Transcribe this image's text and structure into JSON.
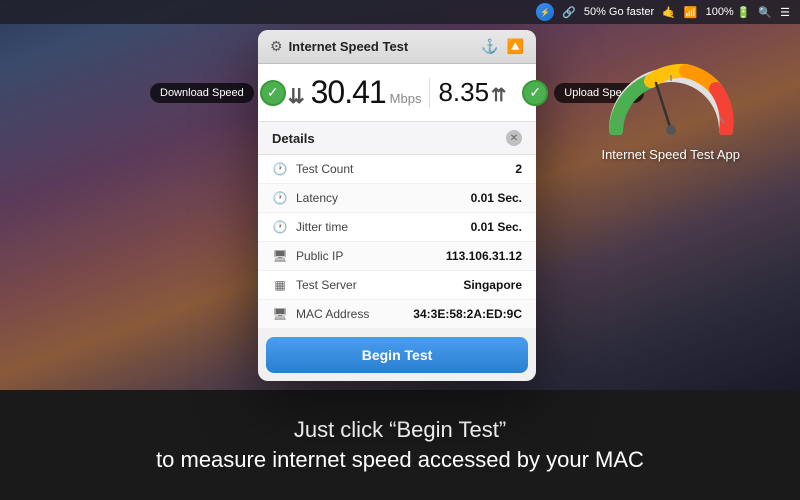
{
  "menubar": {
    "battery_percent": "50%",
    "go_faster": "Go faster",
    "wifi_strength": "100%",
    "battery_full": "100%"
  },
  "window": {
    "title": "Internet Speed Test",
    "gear_icon": "⚙",
    "anchor_icon": "⚓",
    "share_icon": "📤"
  },
  "speeds": {
    "download_value": "30.41",
    "upload_value": "8.35",
    "unit": "Mbps",
    "download_label": "Download Speed",
    "upload_label": "Upload Speed"
  },
  "details": {
    "title": "Details",
    "rows": [
      {
        "icon": "🕐",
        "label": "Test Count",
        "value": "2"
      },
      {
        "icon": "🕐",
        "label": "Latency",
        "value": "0.01 Sec."
      },
      {
        "icon": "🕐",
        "label": "Jitter time",
        "value": "0.01 Sec."
      },
      {
        "icon": "🖥",
        "label": "Public IP",
        "value": "113.106.31.12"
      },
      {
        "icon": "▦",
        "label": "Test Server",
        "value": "Singapore"
      },
      {
        "icon": "🖥",
        "label": "MAC Address",
        "value": "34:3E:58:2A:ED:9C"
      }
    ]
  },
  "begin_test_btn": "Begin Test",
  "speedometer_label": "Internet Speed Test App",
  "bottom_line1": "Just click “Begin Test”",
  "bottom_line2": "to measure internet speed accessed by your MAC"
}
